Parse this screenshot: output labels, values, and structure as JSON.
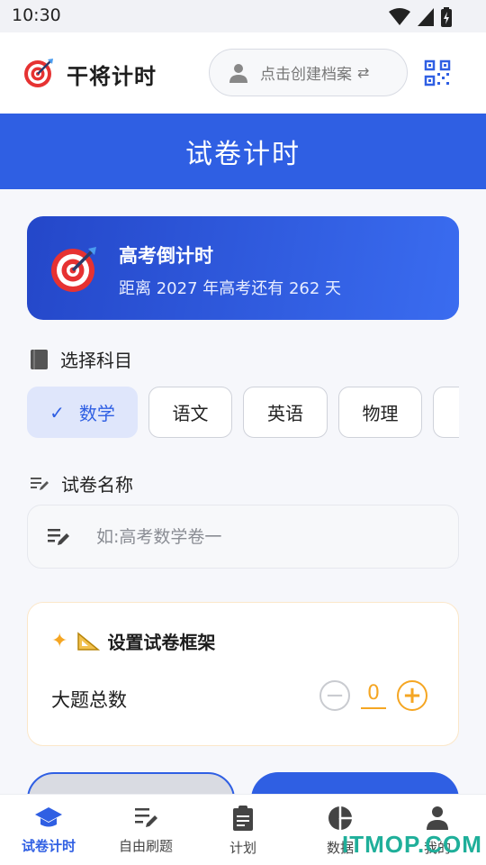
{
  "status_bar": {
    "time": "10:30"
  },
  "app": {
    "title": "干将计时",
    "profile_label": "点击创建档案"
  },
  "banner": {
    "title": "试卷计时"
  },
  "countdown": {
    "title": "高考倒计时",
    "subtitle": "距离 2027 年高考还有 262 天"
  },
  "subject_section": {
    "label": "选择科目",
    "subjects": [
      {
        "label": "数学",
        "selected": true
      },
      {
        "label": "语文",
        "selected": false
      },
      {
        "label": "英语",
        "selected": false
      },
      {
        "label": "物理",
        "selected": false
      }
    ]
  },
  "paper_name": {
    "label": "试卷名称",
    "placeholder": "如:高考数学卷一"
  },
  "framework": {
    "title": "设置试卷框架",
    "total_label": "大题总数",
    "total_value": "0"
  },
  "bottom_nav": {
    "items": [
      {
        "label": "试卷计时",
        "icon": "school-icon",
        "active": true
      },
      {
        "label": "自由刷题",
        "icon": "edit-list-icon",
        "active": false
      },
      {
        "label": "计划",
        "icon": "clipboard-icon",
        "active": false
      },
      {
        "label": "数据",
        "icon": "pie-chart-icon",
        "active": false
      },
      {
        "label": "我的",
        "icon": "person-icon",
        "active": false
      }
    ]
  },
  "watermark": {
    "text": "ITMOP.COM"
  },
  "colors": {
    "primary": "#2f5fe3",
    "accent_orange": "#f5a623",
    "watermark": "#1faf9a"
  }
}
